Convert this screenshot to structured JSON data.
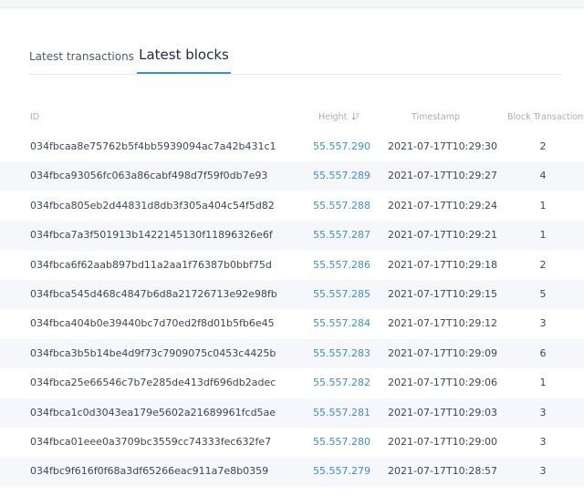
{
  "tabs": {
    "transactions_label": "Latest transactions",
    "blocks_label": "Latest blocks"
  },
  "table": {
    "headers": {
      "id": "ID",
      "height": "Height",
      "timestamp": "Timestamp",
      "block_transactions": "Block Transactions"
    },
    "rows": [
      {
        "id": "034fbcaa8e75762b5f4bb5939094ac7a42b431c1",
        "height": "55.557.290",
        "timestamp": "2021-07-17T10:29:30",
        "tx": "2"
      },
      {
        "id": "034fbca93056fc063a86cabf498d7f59f0db7e93",
        "height": "55.557.289",
        "timestamp": "2021-07-17T10:29:27",
        "tx": "4"
      },
      {
        "id": "034fbca805eb2d44831d8db3f305a404c54f5d82",
        "height": "55.557.288",
        "timestamp": "2021-07-17T10:29:24",
        "tx": "1"
      },
      {
        "id": "034fbca7a3f501913b1422145130f11896326e6f",
        "height": "55.557.287",
        "timestamp": "2021-07-17T10:29:21",
        "tx": "1"
      },
      {
        "id": "034fbca6f62aab897bd11a2aa1f76387b0bbf75d",
        "height": "55.557.286",
        "timestamp": "2021-07-17T10:29:18",
        "tx": "2"
      },
      {
        "id": "034fbca545d468c4847b6d8a21726713e92e98fb",
        "height": "55.557.285",
        "timestamp": "2021-07-17T10:29:15",
        "tx": "5"
      },
      {
        "id": "034fbca404b0e39440bc7d70ed2f8d01b5fb6e45",
        "height": "55.557.284",
        "timestamp": "2021-07-17T10:29:12",
        "tx": "3"
      },
      {
        "id": "034fbca3b5b14be4d9f73c7909075c0453c4425b",
        "height": "55.557.283",
        "timestamp": "2021-07-17T10:29:09",
        "tx": "6"
      },
      {
        "id": "034fbca25e66546c7b7e285de413df696db2adec",
        "height": "55.557.282",
        "timestamp": "2021-07-17T10:29:06",
        "tx": "1"
      },
      {
        "id": "034fbca1c0d3043ea179e5602a21689961fcd5ae",
        "height": "55.557.281",
        "timestamp": "2021-07-17T10:29:03",
        "tx": "3"
      },
      {
        "id": "034fbca01eee0a3709bc3559cc74333fec632fe7",
        "height": "55.557.280",
        "timestamp": "2021-07-17T10:29:00",
        "tx": "3"
      },
      {
        "id": "034fbc9f616f0f68a3df65266eac911a7e8b0359",
        "height": "55.557.279",
        "timestamp": "2021-07-17T10:28:57",
        "tx": "3"
      }
    ]
  },
  "icons": {
    "sort": "sort-descending-icon"
  },
  "colors": {
    "link": "#3d8fd1",
    "active_tab_underline": "#3b8fd8",
    "stripe": "#f5f7fb"
  }
}
